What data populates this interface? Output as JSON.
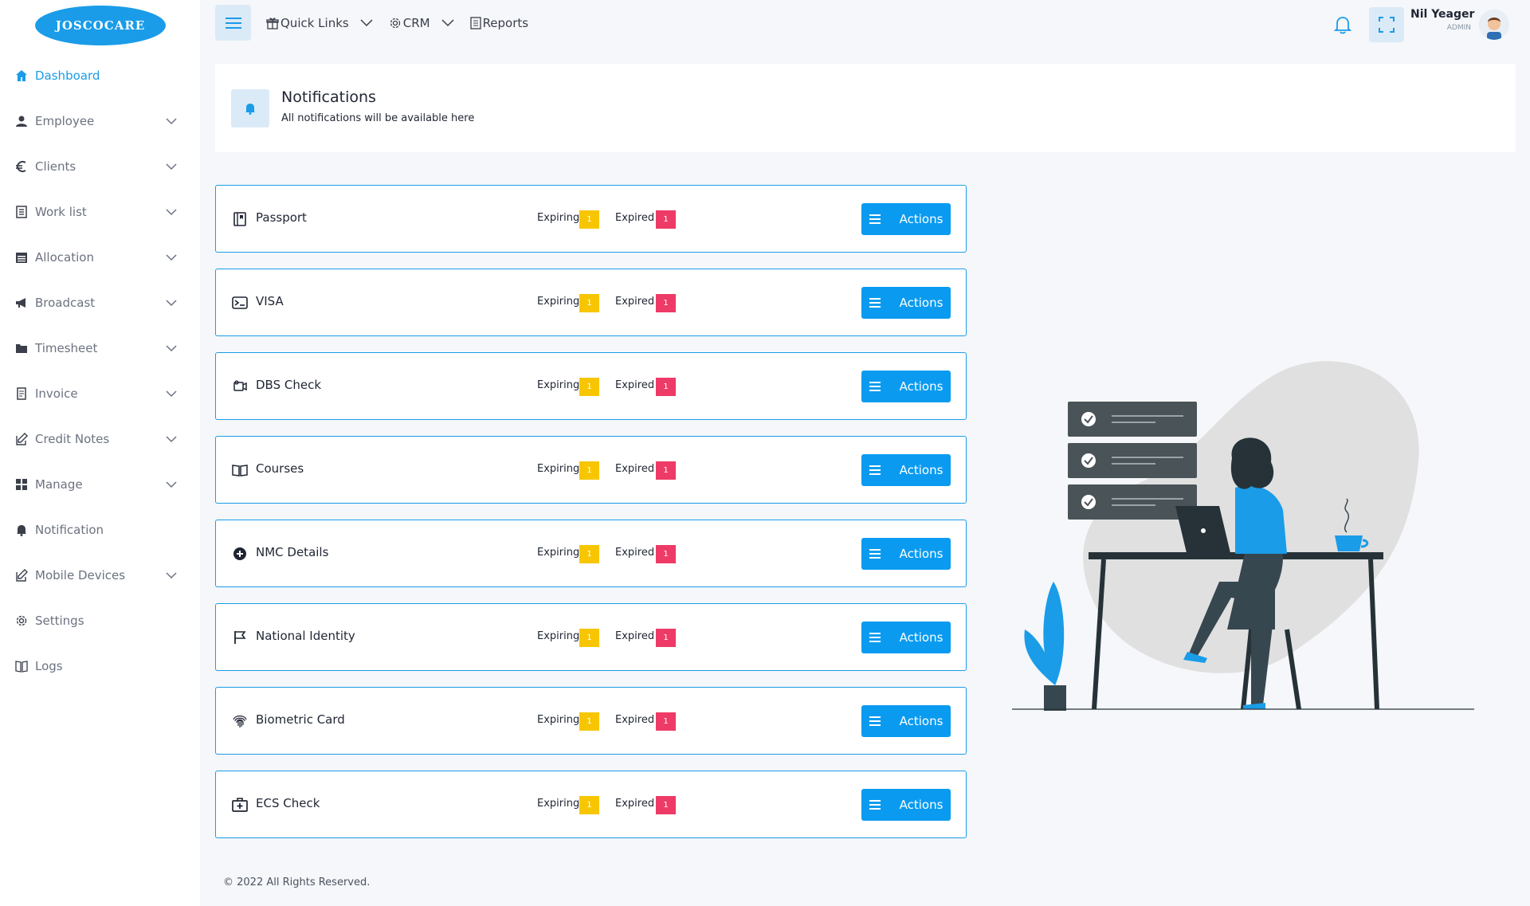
{
  "brand": {
    "logo_text": "JOSCOCARE"
  },
  "sidebar": {
    "items": [
      {
        "label": "Dashboard",
        "icon": "home-icon",
        "active": true,
        "has_children": false
      },
      {
        "label": "Employee",
        "icon": "user-icon",
        "active": false,
        "has_children": true
      },
      {
        "label": "Clients",
        "icon": "euro-icon",
        "active": false,
        "has_children": true
      },
      {
        "label": "Work list",
        "icon": "list-icon",
        "active": false,
        "has_children": true
      },
      {
        "label": "Allocation",
        "icon": "calendar-icon",
        "active": false,
        "has_children": true
      },
      {
        "label": "Broadcast",
        "icon": "megaphone-icon",
        "active": false,
        "has_children": true
      },
      {
        "label": "Timesheet",
        "icon": "folder-icon",
        "active": false,
        "has_children": true
      },
      {
        "label": "Invoice",
        "icon": "receipt-icon",
        "active": false,
        "has_children": true
      },
      {
        "label": "Credit Notes",
        "icon": "edit-icon",
        "active": false,
        "has_children": true
      },
      {
        "label": "Manage",
        "icon": "grid-icon",
        "active": false,
        "has_children": true
      },
      {
        "label": "Notification",
        "icon": "bell-icon",
        "active": false,
        "has_children": false
      },
      {
        "label": "Mobile Devices",
        "icon": "edit-icon",
        "active": false,
        "has_children": true
      },
      {
        "label": "Settings",
        "icon": "gear-icon",
        "active": false,
        "has_children": false
      },
      {
        "label": "Logs",
        "icon": "book-icon",
        "active": false,
        "has_children": false
      }
    ]
  },
  "topbar": {
    "quick_links": "Quick Links",
    "crm": "CRM",
    "reports": "Reports",
    "user_name": "Nil Yeager",
    "user_role": "ADMIN"
  },
  "header": {
    "title": "Notifications",
    "subtitle": "All notifications will be available here"
  },
  "documents": [
    {
      "name": "Passport",
      "icon": "passport-icon",
      "expiring_label": "Expiring",
      "expiring": "1",
      "expired_label": "Expired",
      "expired": "1",
      "action": "Actions"
    },
    {
      "name": "VISA",
      "icon": "visa-icon",
      "expiring_label": "Expiring",
      "expiring": "1",
      "expired_label": "Expired",
      "expired": "1",
      "action": "Actions"
    },
    {
      "name": "DBS Check",
      "icon": "dbs-icon",
      "expiring_label": "Expiring",
      "expiring": "1",
      "expired_label": "Expired",
      "expired": "1",
      "action": "Actions"
    },
    {
      "name": "Courses",
      "icon": "book-open-icon",
      "expiring_label": "Expiring",
      "expiring": "1",
      "expired_label": "Expired",
      "expired": "1",
      "action": "Actions"
    },
    {
      "name": "NMC Details",
      "icon": "plus-circle-icon",
      "expiring_label": "Expiring",
      "expiring": "1",
      "expired_label": "Expired",
      "expired": "1",
      "action": "Actions"
    },
    {
      "name": "National Identity",
      "icon": "flag-icon",
      "expiring_label": "Expiring",
      "expiring": "1",
      "expired_label": "Expired",
      "expired": "1",
      "action": "Actions"
    },
    {
      "name": "Biometric Card",
      "icon": "fingerprint-icon",
      "expiring_label": "Expiring",
      "expiring": "1",
      "expired_label": "Expired",
      "expired": "1",
      "action": "Actions"
    },
    {
      "name": "ECS Check",
      "icon": "first-aid-icon",
      "expiring_label": "Expiring",
      "expiring": "1",
      "expired_label": "Expired",
      "expired": "1",
      "action": "Actions"
    }
  ],
  "footer": {
    "text": "© 2022 All Rights Reserved."
  },
  "colors": {
    "accent": "#1a9ce8",
    "expiring": "#f7c600",
    "expired": "#ee3a66",
    "button": "#0a9bf0"
  }
}
